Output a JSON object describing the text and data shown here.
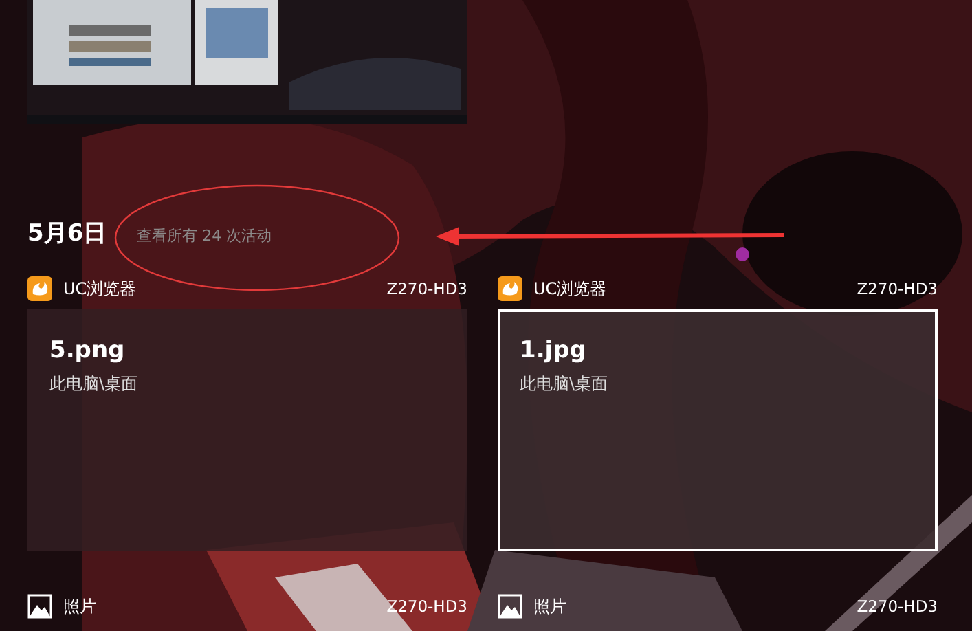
{
  "day": {
    "date": "5月6日",
    "link": "查看所有 24 次活动"
  },
  "annotations": {
    "ellipse_around_link": true,
    "arrow_to_link": true
  },
  "activities": [
    {
      "kind": "browser",
      "app": "UC浏览器",
      "device": "Z270-HD3",
      "title": "5.png",
      "path": "此电脑\\桌面",
      "selected": false
    },
    {
      "kind": "browser",
      "app": "UC浏览器",
      "device": "Z270-HD3",
      "title": "1.jpg",
      "path": "此电脑\\桌面",
      "selected": true
    }
  ],
  "next_activities": [
    {
      "kind": "photos",
      "app": "照片",
      "device": "Z270-HD3"
    },
    {
      "kind": "photos",
      "app": "照片",
      "device": "Z270-HD3"
    }
  ]
}
